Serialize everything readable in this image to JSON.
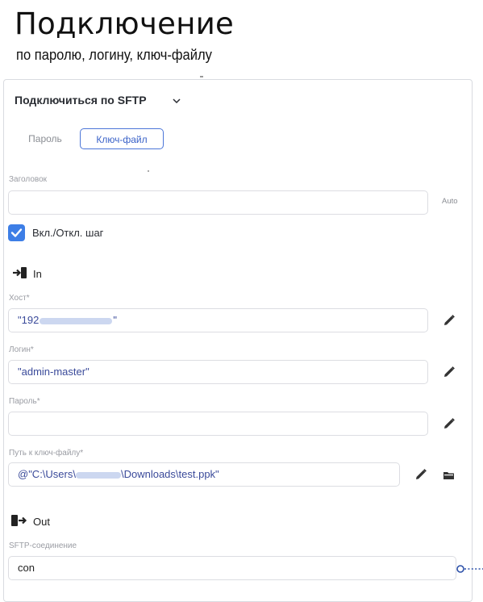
{
  "header": {
    "title": "Подключение",
    "subtitle": "по паролю, логину, ключ-файлу"
  },
  "panel": {
    "title": "Подключиться по SFTP",
    "tabs": [
      {
        "label": "Пароль",
        "selected": false
      },
      {
        "label": "Ключ-файл",
        "selected": true
      }
    ],
    "heading_label": "Заголовок",
    "heading_value": "",
    "auto_button": "Auto",
    "enable_checkbox": {
      "label": "Вкл./Откл. шаг",
      "checked": true
    },
    "in_section": "In",
    "host": {
      "label": "Хост*",
      "value_prefix": "\"192",
      "value_suffix": "\""
    },
    "login": {
      "label": "Логин*",
      "value": "\"admin-master\""
    },
    "password": {
      "label": "Пароль*",
      "value": ""
    },
    "keyfile": {
      "label": "Путь к ключ-файлу*",
      "value_prefix": "@\"C:\\Users\\",
      "value_suffix": "\\Downloads\\test.ppk\""
    },
    "out_section": "Out",
    "sftp_connection": {
      "label": "SFTP-соединение",
      "value": "con"
    }
  },
  "colors": {
    "accent": "#3d7ee6",
    "value_text": "#3a4a9a",
    "label_text": "#9a9ca3"
  },
  "icons": [
    "chevron-down-icon",
    "checkmark-icon",
    "sign-in-icon",
    "pencil-icon",
    "folder-icon",
    "sign-out-icon",
    "connector-port-icon"
  ]
}
